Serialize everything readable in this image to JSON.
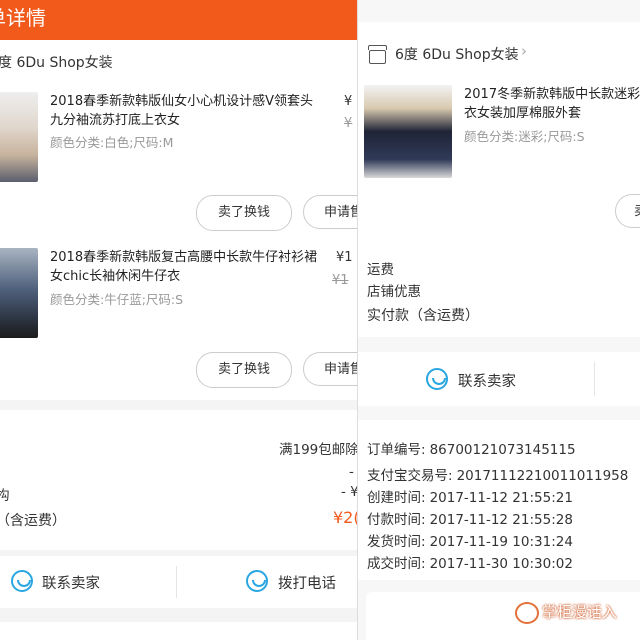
{
  "left": {
    "header_title": "单详情",
    "shop_name": "度 6Du Shop女装",
    "chevron": "›",
    "items": [
      {
        "title": "2018春季新款韩版仙女小心机设计感V领套头九分袖流苏打底上衣女",
        "attr": "颜色分类:白色;尺码:M",
        "price": "¥",
        "orig_price": "¥",
        "btn_sell": "卖了换钱",
        "btn_apply": "申请售"
      },
      {
        "title": "2018春季新款韩版复古高腰中长款牛仔衬衫裙女chic长袖休闲牛仔衣",
        "attr": "颜色分类:牛仔蓝;尺码:S",
        "price": "¥1",
        "orig_price": "¥1",
        "btn_sell": "卖了换钱",
        "btn_apply": "申请售"
      }
    ],
    "promo": "满199包邮除",
    "dash1": "-",
    "dash2": "- ¥",
    "shop_promo_fragment": "构",
    "total_label": "（含运费）",
    "total_value": "¥2(",
    "contact_seller": "联系卖家",
    "call_phone": "拨打电话"
  },
  "right": {
    "shop_name": "6度 6Du Shop女装",
    "chevron": "›",
    "item": {
      "title": "2017冬季新款韩版中长款迷彩棉衣女装加厚棉服外套",
      "attr": "颜色分类:迷彩;尺码:S",
      "btn_partial": "卖"
    },
    "shipping": "运费",
    "shop_discount": "店铺优惠",
    "actual_paid": "实付款（含运费）",
    "contact_seller": "联系卖家",
    "order_info": [
      {
        "label": "订单编号:",
        "value": "86700121073145115"
      },
      {
        "label": "支付宝交易号:",
        "value": "20171112210011011958"
      },
      {
        "label": "创建时间:",
        "value": "2017-11-12 21:55:21"
      },
      {
        "label": "付款时间:",
        "value": "2017-11-12 21:55:28"
      },
      {
        "label": "发货时间:",
        "value": "2017-11-19 10:31:24"
      },
      {
        "label": "成交时间:",
        "value": "2017-11-30 10:30:02"
      }
    ]
  },
  "watermark": "掌柜漫话入",
  "colors": {
    "header": "#f25a1c",
    "accent_orange": "#f25a1c",
    "icon_blue": "#2aa6e0"
  }
}
